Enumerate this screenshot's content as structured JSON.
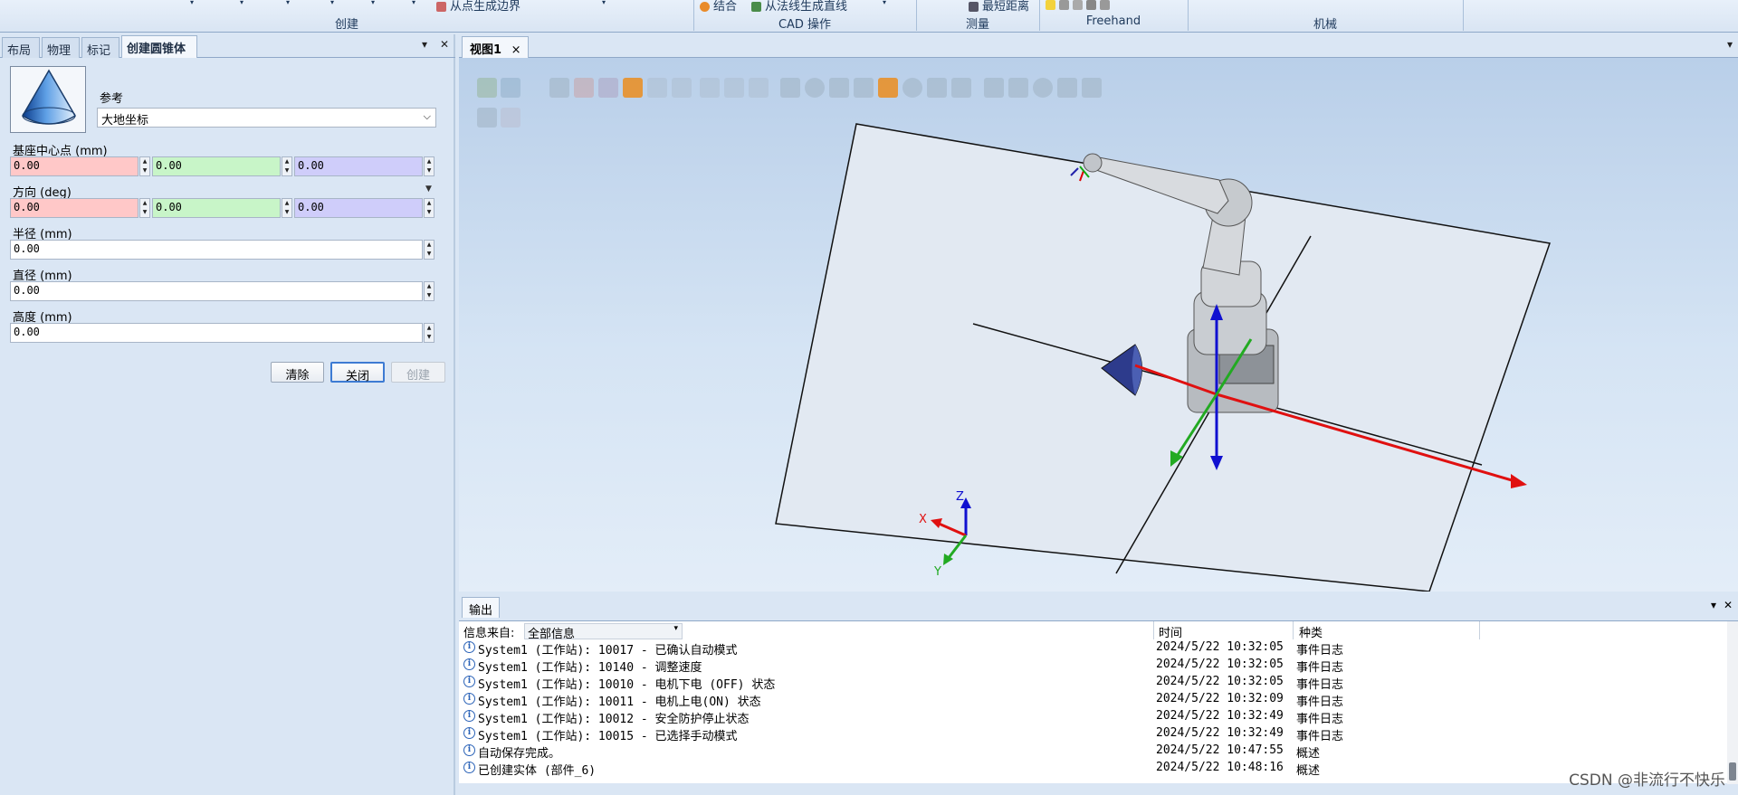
{
  "ribbon": {
    "groups": [
      "创建",
      "CAD 操作",
      "测量",
      "Freehand",
      "机械"
    ],
    "items": [
      "从点生成边界",
      "结合",
      "从法线生成直线",
      "最短距离"
    ]
  },
  "left_panel": {
    "tabs": [
      "布局",
      "物理",
      "标记",
      "创建圆锥体"
    ],
    "reference_label": "参考",
    "reference_value": "大地坐标",
    "base_center_label": "基座中心点 (mm)",
    "base_center": [
      "0.00",
      "0.00",
      "0.00"
    ],
    "direction_label": "方向 (deg)",
    "direction": [
      "0.00",
      "0.00",
      "0.00"
    ],
    "radius_label": "半径 (mm)",
    "radius": "0.00",
    "diameter_label": "直径 (mm)",
    "diameter": "0.00",
    "height_label": "高度 (mm)",
    "height": "0.00",
    "buttons": {
      "clear": "清除",
      "close": "关闭",
      "create": "创建"
    }
  },
  "viewport": {
    "tab": "视图1",
    "axis_labels": {
      "x": "X",
      "y": "Y",
      "z": "Z"
    }
  },
  "output": {
    "tab": "输出",
    "source_label": "信息来自:",
    "source_value": "全部信息",
    "col_time": "时间",
    "col_category": "种类",
    "rows": [
      {
        "msg": "System1 (工作站): 10017 - 已确认自动模式",
        "time": "2024/5/22 10:32:05",
        "cat": "事件日志"
      },
      {
        "msg": "System1 (工作站): 10140 - 调整速度",
        "time": "2024/5/22 10:32:05",
        "cat": "事件日志"
      },
      {
        "msg": "System1 (工作站): 10010 - 电机下电 (OFF) 状态",
        "time": "2024/5/22 10:32:05",
        "cat": "事件日志"
      },
      {
        "msg": "System1 (工作站): 10011 - 电机上电(ON) 状态",
        "time": "2024/5/22 10:32:09",
        "cat": "事件日志"
      },
      {
        "msg": "System1 (工作站): 10012 - 安全防护停止状态",
        "time": "2024/5/22 10:32:49",
        "cat": "事件日志"
      },
      {
        "msg": "System1 (工作站): 10015 - 已选择手动模式",
        "time": "2024/5/22 10:32:49",
        "cat": "事件日志"
      },
      {
        "msg": "自动保存完成。",
        "time": "2024/5/22 10:47:55",
        "cat": "概述"
      },
      {
        "msg": "已创建实体 (部件_6)",
        "time": "2024/5/22 10:48:16",
        "cat": "概述"
      }
    ]
  },
  "watermark": "CSDN @非流行不快乐",
  "colors": {
    "x_field": "#ffc8c8",
    "y_field": "#c8f5c8",
    "z_field": "#cfcdfa",
    "axis_x": "#e01010",
    "axis_y": "#22aa22",
    "axis_z": "#1010d0"
  }
}
